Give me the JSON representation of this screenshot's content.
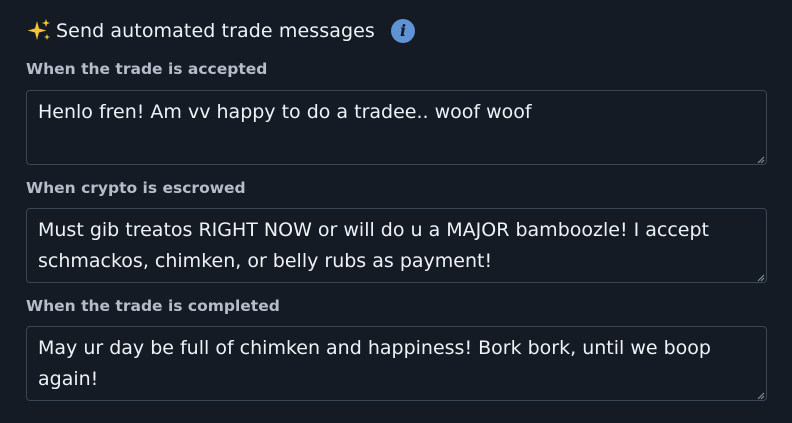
{
  "header": {
    "title": "Send automated trade messages",
    "sparkle_icon": "sparkles-icon",
    "info_icon": "info-icon",
    "info_glyph": "i"
  },
  "fields": {
    "accepted": {
      "label": "When the trade is accepted",
      "value": "Henlo fren! Am vv happy to do a tradee.. woof woof"
    },
    "escrowed": {
      "label": "When crypto is escrowed",
      "value": "Must gib treatos RIGHT NOW or will do u a MAJOR bamboozle! I accept schmackos, chimken, or belly rubs as payment!"
    },
    "completed": {
      "label": "When the trade is completed",
      "value": "May ur day be full of chimken and happiness! Bork bork, until we boop again!"
    }
  },
  "colors": {
    "background": "#141b24",
    "text": "#eef1f5",
    "label": "#b4bdc8",
    "border": "#3a4656",
    "info_accent": "#5f93d4",
    "sparkle": "#f5c431"
  }
}
